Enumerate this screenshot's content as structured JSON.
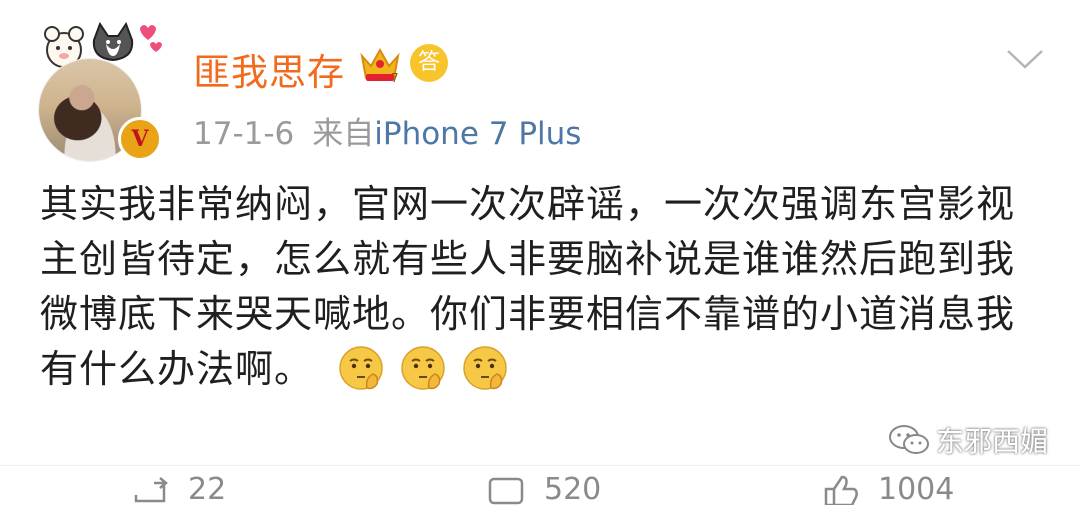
{
  "user": {
    "name": "匪我思存",
    "badge_letter": "V",
    "answer_badge": "答"
  },
  "post": {
    "date": "17-1-6",
    "via": "来自",
    "device": "iPhone 7 Plus",
    "text": "其实我非常纳闷，官网一次次辟谣，一次次强调东宫影视主创皆待定，怎么就有些人非要脑补说是谁谁然后跑到我微博底下来哭天喊地。你们非要相信不靠谱的小道消息我有什么办法啊。",
    "emoji_count": 3
  },
  "watermark": {
    "text": "东邪西媚"
  },
  "actions": {
    "repost_count": "22",
    "comment_count": "520",
    "like_count": "1004"
  },
  "colors": {
    "username": "#f26a1b",
    "device_link": "#4d78a6",
    "meta": "#9a9a9a"
  }
}
